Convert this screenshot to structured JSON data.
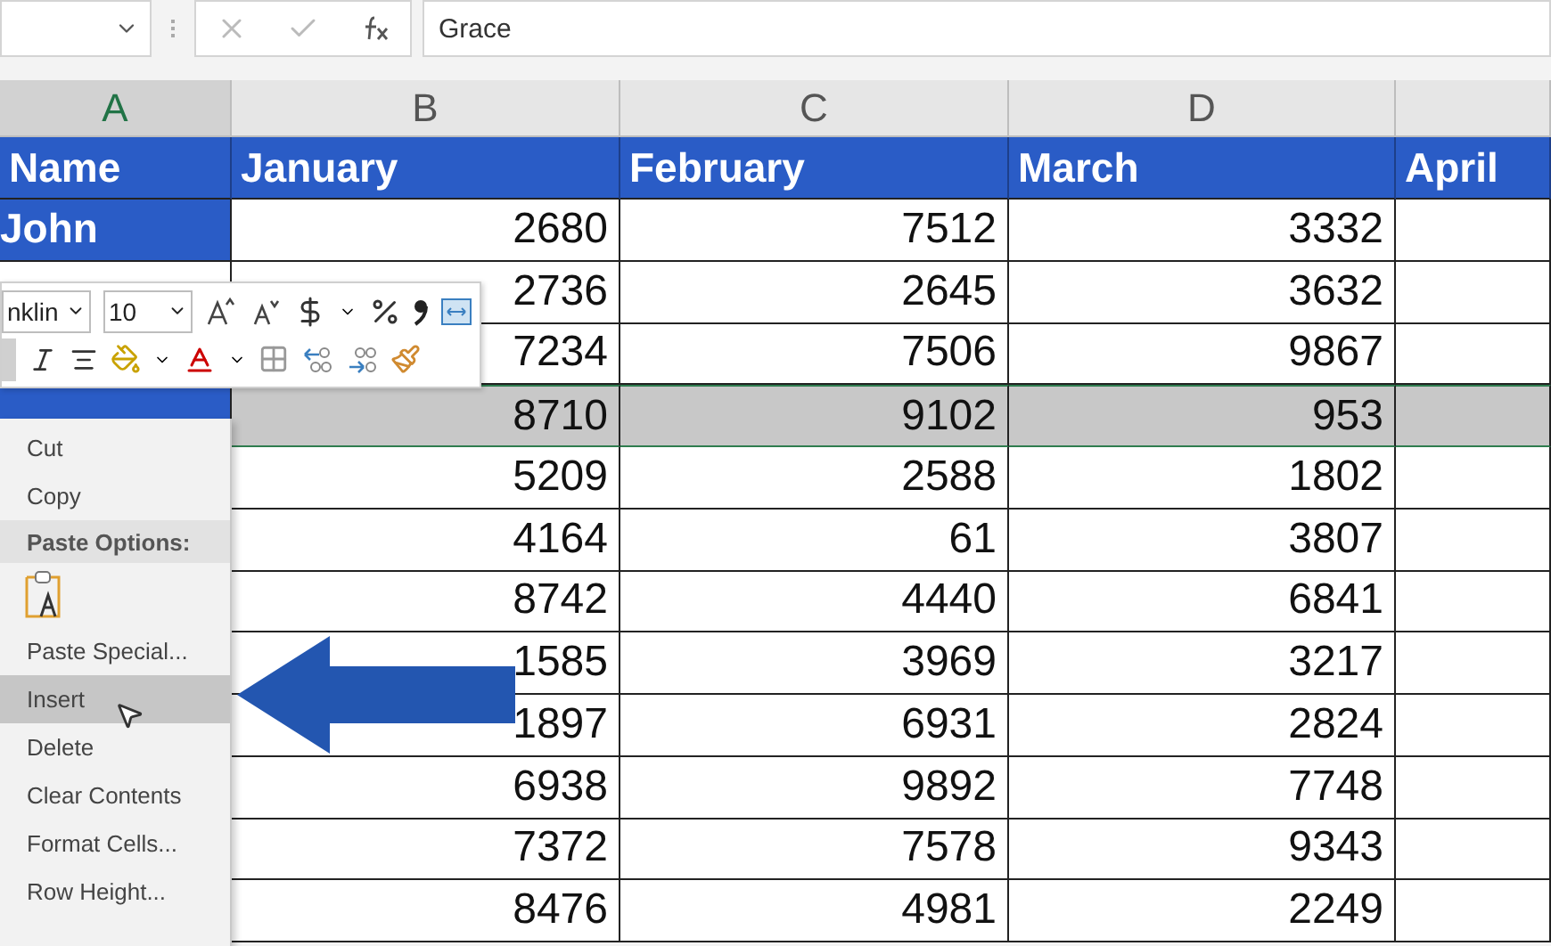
{
  "formula_bar": {
    "formula": "Grace"
  },
  "column_headers": [
    {
      "label": "A",
      "selected": true
    },
    {
      "label": "B",
      "selected": false
    },
    {
      "label": "C",
      "selected": false
    },
    {
      "label": "D",
      "selected": false
    },
    {
      "selected": false
    }
  ],
  "table": {
    "columns": [
      "Name",
      "January",
      "February",
      "March",
      "April"
    ],
    "rows": [
      {
        "name": "John",
        "values": [
          "2680",
          "7512",
          "3332"
        ],
        "selected": false
      },
      {
        "values": [
          "2736",
          "2645",
          "3632"
        ],
        "selected": false
      },
      {
        "values": [
          "7234",
          "7506",
          "9867"
        ],
        "selected": false
      },
      {
        "values": [
          "8710",
          "9102",
          "953"
        ],
        "selected": true
      },
      {
        "values": [
          "5209",
          "2588",
          "1802"
        ],
        "selected": false
      },
      {
        "values": [
          "4164",
          "61",
          "3807"
        ],
        "selected": false
      },
      {
        "values": [
          "8742",
          "4440",
          "6841"
        ],
        "selected": false
      },
      {
        "values": [
          "1585",
          "3969",
          "3217"
        ],
        "selected": false
      },
      {
        "values": [
          "1897",
          "6931",
          "2824"
        ],
        "selected": false
      },
      {
        "values": [
          "6938",
          "9892",
          "7748"
        ],
        "selected": false
      },
      {
        "values": [
          "7372",
          "7578",
          "9343"
        ],
        "selected": false
      },
      {
        "values": [
          "8476",
          "4981",
          "2249"
        ],
        "selected": false
      }
    ]
  },
  "mini_toolbar": {
    "font": "nklin",
    "size": "10"
  },
  "context_menu": [
    {
      "kind": "item",
      "label": "Cut",
      "selected": false
    },
    {
      "kind": "item",
      "label": "Copy",
      "selected": false
    },
    {
      "kind": "header",
      "label": "Paste Options:"
    },
    {
      "kind": "paste"
    },
    {
      "kind": "item",
      "label": "Paste Special...",
      "selected": false
    },
    {
      "kind": "item",
      "label": "Insert",
      "selected": true
    },
    {
      "kind": "item",
      "label": "Delete",
      "selected": false
    },
    {
      "kind": "item",
      "label": "Clear Contents",
      "selected": false
    },
    {
      "kind": "item",
      "label": "Format Cells...",
      "selected": false
    },
    {
      "kind": "item",
      "label": "Row Height...",
      "selected": false
    }
  ]
}
